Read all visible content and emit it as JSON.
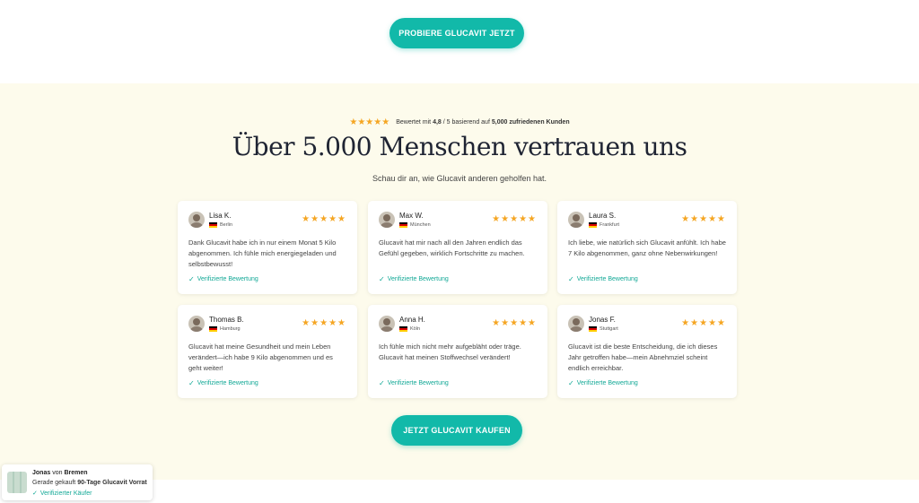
{
  "cta_top": "PROBIERE GLUCAVIT JETZT",
  "rating": {
    "prefix": "Bewertet mit",
    "score": "4,8",
    "middle": "/ 5 basierend auf",
    "count": "5,000 zufriedenen Kunden",
    "stars": "★★★★★"
  },
  "headline": "Über 5.000 Menschen vertrauen uns",
  "subheadline": "Schau dir an, wie Glucavit anderen geholfen hat.",
  "reviews": [
    {
      "name": "Lisa K.",
      "city": "Berlin",
      "stars": "★★★★★",
      "text": "Dank Glucavit habe ich in nur einem Monat 5 Kilo abgenommen. Ich fühle mich energiegeladen und selbstbewusst!",
      "verified": "Verifizierte Bewertung"
    },
    {
      "name": "Max W.",
      "city": "München",
      "stars": "★★★★★",
      "text": "Glucavit hat mir nach all den Jahren endlich das Gefühl gegeben, wirklich Fortschritte zu machen.",
      "verified": "Verifizierte Bewertung"
    },
    {
      "name": "Laura S.",
      "city": "Frankfurt",
      "stars": "★★★★★",
      "text": "Ich liebe, wie natürlich sich Glucavit anfühlt. Ich habe 7 Kilo abgenommen, ganz ohne Nebenwirkungen!",
      "verified": "Verifizierte Bewertung"
    },
    {
      "name": "Thomas B.",
      "city": "Hamburg",
      "stars": "★★★★★",
      "text": "Glucavit hat meine Gesundheit und mein Leben verändert—ich habe 9 Kilo abgenommen und es geht weiter!",
      "verified": "Verifizierte Bewertung"
    },
    {
      "name": "Anna H.",
      "city": "Köln",
      "stars": "★★★★★",
      "text": "Ich fühle mich nicht mehr aufgebläht oder träge. Glucavit hat meinen Stoffwechsel verändert!",
      "verified": "Verifizierte Bewertung"
    },
    {
      "name": "Jonas F.",
      "city": "Stuttgart",
      "stars": "★★★★★",
      "text": "Glucavit ist die beste Entscheidung, die ich dieses Jahr getroffen habe—mein Abnehmziel scheint endlich erreichbar.",
      "verified": "Verifizierte Bewertung"
    }
  ],
  "cta_bottom": "JETZT GLUCAVIT KAUFEN",
  "toast": {
    "name": "Jonas",
    "von": "von",
    "city": "Bremen",
    "bought_prefix": "Gerade gekauft",
    "product": "90-Tage Glucavit Vorrat",
    "verified": "Verifizierter Käufer"
  },
  "colors": {
    "accent": "#12b9a9",
    "section_bg": "#fdfbec",
    "star": "#f5a623"
  }
}
